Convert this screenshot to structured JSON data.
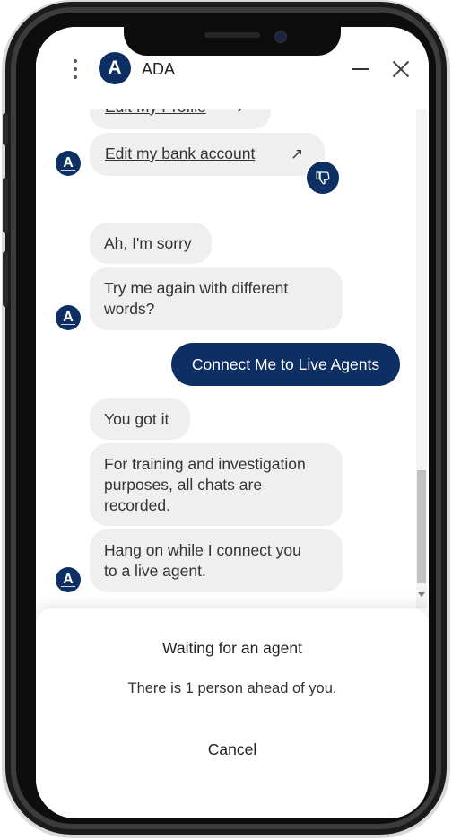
{
  "header": {
    "avatar_letter": "A",
    "title": "ADA",
    "menu_icon": "kebab-menu-icon",
    "minimize_icon": "minimize-icon",
    "close_icon": "close-icon"
  },
  "messages": {
    "link_edit_profile": "Edit My Profile",
    "link_edit_bank": "Edit my bank account",
    "link_arrow": "↗",
    "bot_sorry": "Ah, I'm sorry",
    "bot_try_again_line1": "Try me again with different",
    "bot_try_again_line2": "words?",
    "user_message": "Connect Me to Live Agents",
    "bot_got_it": "You got it",
    "bot_training_line1": "For training and investigation",
    "bot_training_line2": "purposes, all chats are",
    "bot_training_line3": "recorded.",
    "bot_hang_on_line1": "Hang on while I connect you",
    "bot_hang_on_line2": "to a live agent.",
    "avatar_letter": "A",
    "feedback_icon": "thumbs-down-icon"
  },
  "waiting_panel": {
    "title": "Waiting for an agent",
    "queue_status": "There is 1 person ahead of you.",
    "cancel_label": "Cancel"
  },
  "colors": {
    "brand_navy": "#0e2f63",
    "bot_bubble": "#efefef",
    "page_background": "#ffffff"
  }
}
